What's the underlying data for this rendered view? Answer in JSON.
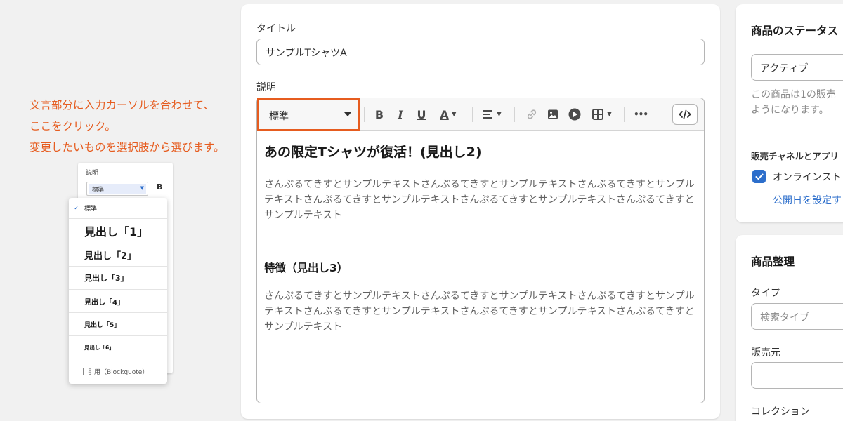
{
  "annotation": {
    "line1": "文言部分に入力カーソルを合わせて、",
    "line2": "ここをクリック。",
    "line3": "変更したいものを選択肢から選びます。"
  },
  "inset": {
    "label": "説明",
    "select_value": "標準",
    "bold_glyph": "B",
    "menu_items": [
      {
        "label": "標準",
        "selected": true
      },
      {
        "label": "見出し「1」"
      },
      {
        "label": "見出し「2」"
      },
      {
        "label": "見出し「3」"
      },
      {
        "label": "見出し「4」"
      },
      {
        "label": "見出し「5」"
      },
      {
        "label": "見出し「6」"
      },
      {
        "label": "引用（Blockquote）"
      }
    ]
  },
  "form": {
    "title_label": "タイトル",
    "title_value": "サンプルTシャツA",
    "description_label": "説明",
    "format_select_value": "標準",
    "toolbar": {
      "bold": "B",
      "italic": "I",
      "underline": "U",
      "text_color": "A",
      "more": "•••"
    },
    "content": {
      "heading2": "あの限定Tシャツが復活！(見出し2)",
      "paragraph1": "さんぷるてきすとサンプルテキストさんぷるてきすとサンプルテキストさんぷるてきすとサンプルテキストさんぷるてきすとサンプルテキストさんぷるてきすとサンプルテキストさんぷるてきすとサンプルテキスト",
      "heading3": "特徴（見出し3）",
      "paragraph2": "さんぷるてきすとサンプルテキストさんぷるてきすとサンプルテキストさんぷるてきすとサンプルテキストさんぷるてきすとサンプルテキストさんぷるてきすとサンプルテキストさんぷるてきすとサンプルテキスト"
    }
  },
  "sidebar": {
    "status_title": "商品のステータス",
    "status_value": "アクティブ",
    "status_help_1": "この商品は1の販売",
    "status_help_2": "ようになります。",
    "channels_label": "販売チャネルとアプリ",
    "online_store": "オンラインスト",
    "publish_date_link": "公開日を設定す",
    "organize_title": "商品整理",
    "type_label": "タイプ",
    "type_placeholder": "検索タイプ",
    "vendor_label": "販売元",
    "collection_label": "コレクション"
  },
  "colors": {
    "accent_orange": "#e65c1f",
    "primary_blue": "#2c6ecb"
  }
}
